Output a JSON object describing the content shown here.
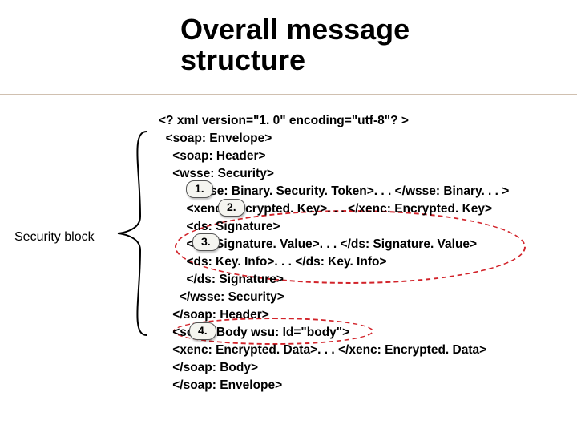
{
  "title_line1": "Overall message",
  "title_line2": "structure",
  "label": "Security block",
  "code": {
    "l1": "<? xml version=\"1. 0\" encoding=\"utf-8\"? >",
    "l2": "  <soap: Envelope>",
    "l3": "    <soap: Header>",
    "l4": "    <wsse: Security>",
    "l5": "        <wsse: Binary. Security. Token>. . . </wsse: Binary. . . >",
    "l6": "        <xenc: Encrypted. Key>. . . </xenc: Encrypted. Key>",
    "l7": "        <ds: Signature>",
    "l8": "        <ds: Signature. Value>. . . </ds: Signature. Value>",
    "l9": "        <ds: Key. Info>. . . </ds: Key. Info>",
    "l10": "        </ds: Signature>",
    "l11": "      </wsse: Security>",
    "l12": "    </soap: Header>",
    "l13": "    <soap: Body wsu: Id=\"body\">",
    "l14": "    <xenc: Encrypted. Data>. . . </xenc: Encrypted. Data>",
    "l15": "    </soap: Body>",
    "l16": "    </soap: Envelope>"
  },
  "badges": {
    "b1": "1.",
    "b2": "2.",
    "b3": "3.",
    "b4": "4."
  },
  "colors": {
    "accent_red": "#d2232a"
  }
}
